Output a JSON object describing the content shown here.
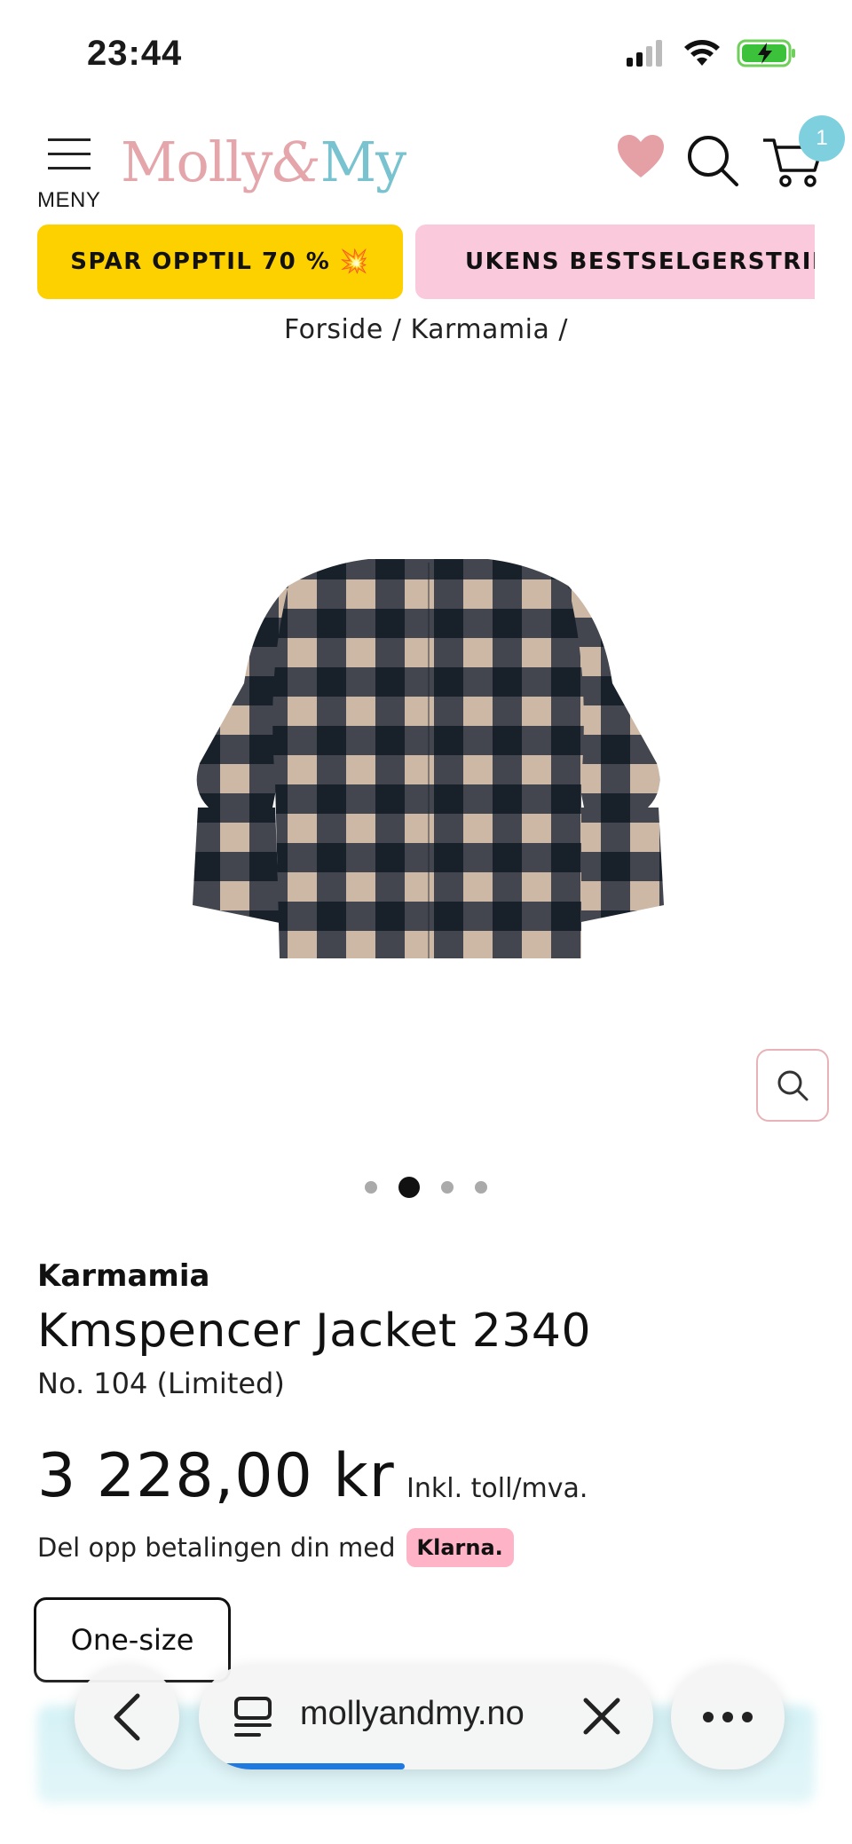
{
  "status_bar": {
    "time": "23:44",
    "icons": [
      "signal-icon",
      "wifi-icon",
      "battery-charging-icon"
    ]
  },
  "header": {
    "menu_label": "MENY",
    "logo": {
      "part1": "Molly",
      "part2": "&",
      "part3": "My"
    },
    "cart_count": "1",
    "icons": [
      "hamburger-menu-icon",
      "heart-icon",
      "search-icon",
      "cart-icon"
    ]
  },
  "promos": [
    {
      "label": "SPAR OPPTIL 70 % 💥",
      "color": "#fdd000"
    },
    {
      "label": "UKENS BESTSELGERSTRIKK 💖",
      "color": "#fbc9dc"
    }
  ],
  "breadcrumb": "Forside / Karmamia /",
  "gallery": {
    "image_alt": "Checked jacket",
    "slide_count": 4,
    "active_slide": 2
  },
  "product": {
    "brand": "Karmamia",
    "title": "Kmspencer Jacket 2340",
    "variant": "No. 104 (Limited)",
    "price": "3 228,00 kr",
    "price_note": "Inkl. toll/mva.",
    "klarna_text": "Del opp betalingen din med",
    "klarna_badge": "Klarna.",
    "size_option": "One-size"
  },
  "browser": {
    "url": "mollyandmy.no",
    "load_progress": 0.4
  },
  "colors": {
    "logo_pink": "#e4a6ab",
    "logo_teal": "#79c2cf",
    "cart_badge": "#7fd0df",
    "klarna_pink": "#ffb3c7"
  }
}
